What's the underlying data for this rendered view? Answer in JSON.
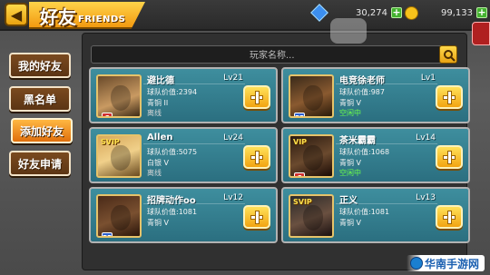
{
  "header": {
    "title": "好友",
    "title_en": "FRIENDS",
    "gems": "30,274",
    "coins": "99,133"
  },
  "tabs": [
    {
      "label": "我的好友",
      "active": false
    },
    {
      "label": "黑名单",
      "active": false
    },
    {
      "label": "添加好友",
      "active": true
    },
    {
      "label": "好友申请",
      "active": false
    }
  ],
  "search": {
    "placeholder": "玩家名称..."
  },
  "friends": [
    {
      "name": "避比德",
      "level": "Lv21",
      "value": "球队价值:2394",
      "rank": "青铜 II",
      "status": "离线",
      "vip": "",
      "position": "C"
    },
    {
      "name": "电竞徐老师",
      "level": "Lv1",
      "value": "球队价值:987",
      "rank": "青铜 V",
      "status": "空闲中",
      "vip": "",
      "position": "PF"
    },
    {
      "name": "Allen",
      "level": "Lv24",
      "value": "球队价值:5075",
      "rank": "白银 V",
      "status": "离线",
      "vip": "SVIP",
      "position": ""
    },
    {
      "name": "茶米霸霸",
      "level": "Lv14",
      "value": "球队价值:1068",
      "rank": "青铜 V",
      "status": "空闲中",
      "vip": "VIP",
      "position": "C"
    },
    {
      "name": "招牌动作oo",
      "level": "Lv12",
      "value": "球队价值:1081",
      "rank": "青铜 V",
      "status": "",
      "vip": "",
      "position": "PF"
    },
    {
      "name": "正义",
      "level": "Lv13",
      "value": "球队价值:1081",
      "rank": "青铜 V",
      "status": "",
      "vip": "SVIP",
      "position": ""
    }
  ],
  "watermark": "华南手游网",
  "colors": {
    "card_bg": "#2f7f90",
    "active_tab": "#f08a1e",
    "online": "#6cff4a",
    "accent_yellow": "#f7c21b"
  },
  "icons": [
    "back-arrow-icon",
    "gem-icon",
    "coin-icon",
    "search-icon",
    "add-friend-plus-icon"
  ]
}
